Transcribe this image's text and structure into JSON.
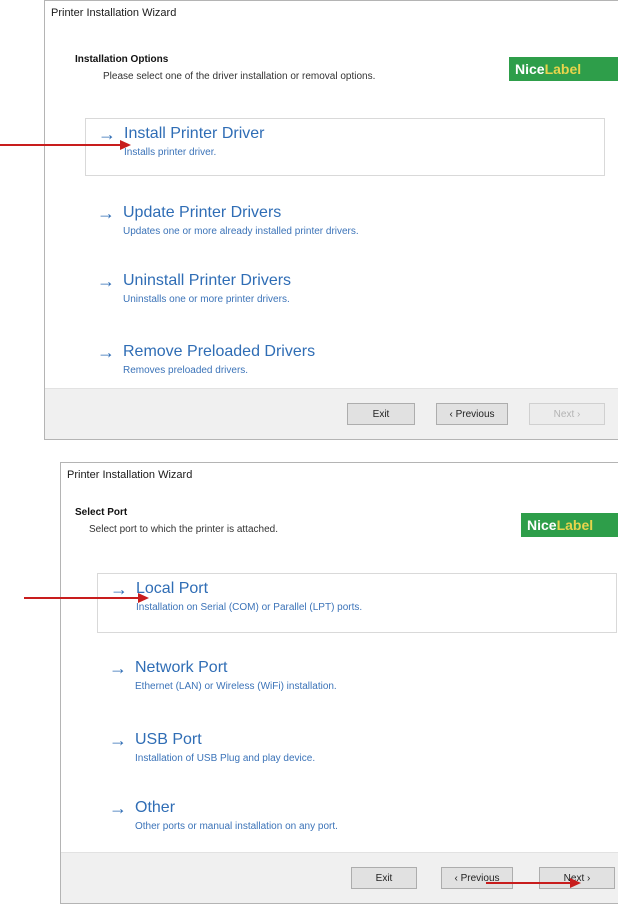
{
  "wizard1": {
    "title": "Printer Installation Wizard",
    "header_title": "Installation Options",
    "header_subtitle": "Please select one of the driver installation or removal options.",
    "logo": {
      "part1": "Nice",
      "part2": "Label"
    },
    "options": [
      {
        "title": "Install Printer Driver",
        "desc": "Installs printer driver."
      },
      {
        "title": "Update Printer Drivers",
        "desc": "Updates one or more already installed printer drivers."
      },
      {
        "title": "Uninstall Printer Drivers",
        "desc": "Uninstalls one or more printer drivers."
      },
      {
        "title": "Remove Preloaded Drivers",
        "desc": "Removes preloaded drivers."
      }
    ],
    "buttons": {
      "exit": "Exit",
      "previous": "‹ Previous",
      "next": "Next ›"
    }
  },
  "wizard2": {
    "title": "Printer Installation Wizard",
    "header_title": "Select Port",
    "header_subtitle": "Select port to which the printer is attached.",
    "logo": {
      "part1": "Nice",
      "part2": "Label"
    },
    "options": [
      {
        "title": "Local Port",
        "desc": "Installation on Serial (COM) or Parallel (LPT) ports."
      },
      {
        "title": "Network Port",
        "desc": "Ethernet (LAN) or Wireless (WiFi) installation."
      },
      {
        "title": "USB Port",
        "desc": "Installation of USB Plug and play device."
      },
      {
        "title": "Other",
        "desc": "Other ports or manual installation on any port."
      }
    ],
    "buttons": {
      "exit": "Exit",
      "previous": "‹ Previous",
      "next": "Next ›"
    }
  },
  "icons": {
    "option_arrow": "→",
    "annotation": "red-arrow-icon"
  },
  "colors": {
    "accent": "#2f6db5",
    "brand": "#2e9e4a",
    "annotation": "#c81d1d"
  }
}
